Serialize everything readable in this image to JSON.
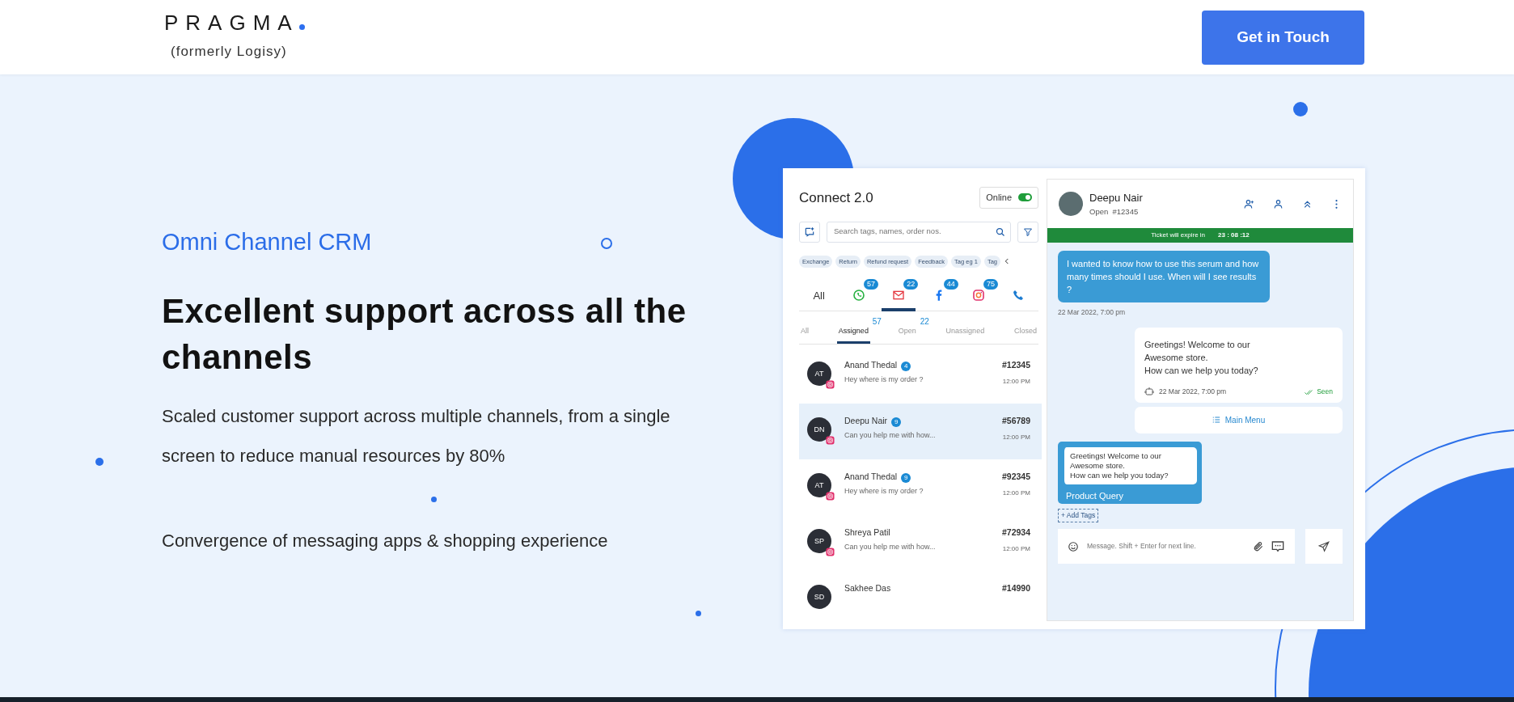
{
  "header": {
    "logo": "PRAGMA",
    "logo_sub": "(formerly Logisy)",
    "cta": "Get in Touch"
  },
  "hero": {
    "eyebrow": "Omni Channel CRM",
    "title": "Excellent support across all the channels",
    "paragraphs": [
      "Scaled customer support across multiple channels, from a single screen to reduce manual resources by 80%",
      "Convergence of messaging apps & shopping experience"
    ]
  },
  "app": {
    "title": "Connect 2.0",
    "status": {
      "label": "Online",
      "on": true
    },
    "search": {
      "placeholder": "Search tags, names, order nos."
    },
    "tags": [
      "Exchange",
      "Return",
      "Refund request",
      "Feedback",
      "Tag eg 1",
      "Tag"
    ],
    "channels": [
      {
        "kind": "all",
        "label": "All",
        "selected": false
      },
      {
        "kind": "whatsapp",
        "count": "57",
        "selected": false
      },
      {
        "kind": "email",
        "count": "22",
        "selected": true
      },
      {
        "kind": "facebook",
        "count": "44",
        "selected": false
      },
      {
        "kind": "instagram",
        "count": "75",
        "selected": false
      },
      {
        "kind": "phone",
        "selected": false
      }
    ],
    "filters": [
      {
        "label": "All",
        "selected": false
      },
      {
        "label": "Assigned",
        "count": "57",
        "selected": true
      },
      {
        "label": "Open",
        "count": "22",
        "selected": false
      },
      {
        "label": "Unassigned",
        "selected": false
      },
      {
        "label": "Closed",
        "selected": false
      }
    ],
    "conversations": [
      {
        "initials": "AT",
        "name": "Anand Thedal",
        "unread": "4",
        "preview": "Hey where is my order ?",
        "ticket": "#12345",
        "time": "12:00 PM",
        "selected": false
      },
      {
        "initials": "DN",
        "name": "Deepu Nair",
        "unread": "9",
        "preview": "Can you help me with how...",
        "ticket": "#56789",
        "time": "12:00 PM",
        "selected": true
      },
      {
        "initials": "AT",
        "name": "Anand Thedal",
        "unread": "9",
        "preview": "Hey where is my order ?",
        "ticket": "#92345",
        "time": "12:00 PM",
        "selected": false
      },
      {
        "initials": "SP",
        "name": "Shreya Patil",
        "preview": "Can you help me with how...",
        "ticket": "#72934",
        "time": "12:00 PM",
        "selected": false
      },
      {
        "initials": "SD",
        "name": "Sakhee Das",
        "ticket": "#14990",
        "selected": false
      }
    ],
    "chat": {
      "name": "Deepu Nair",
      "status": "Open",
      "ticket": "#12345",
      "expiry_label": "Ticket will expire in",
      "expiry_time": "23 : 08 :12",
      "messages": [
        {
          "kind": "incoming",
          "text": "I wanted to know how to use this serum and how many times should I use. When will I see results ?",
          "time": "22 Mar 2022, 7:00 pm"
        },
        {
          "kind": "outgoing",
          "text": "Greetings! Welcome to our\nAwesome store.\nHow can we help you today?",
          "time": "22 Mar 2022, 7:00 pm",
          "seen": "Seen"
        },
        {
          "kind": "menu",
          "text": "Main Menu"
        },
        {
          "kind": "quoted",
          "text": "Greetings! Welcome to our\nAwesome store.\nHow can we help you today?",
          "label": "Product Query"
        }
      ],
      "add_tags": "+ Add Tags",
      "composer": {
        "placeholder": "Message. Shift + Enter for next line."
      }
    }
  }
}
